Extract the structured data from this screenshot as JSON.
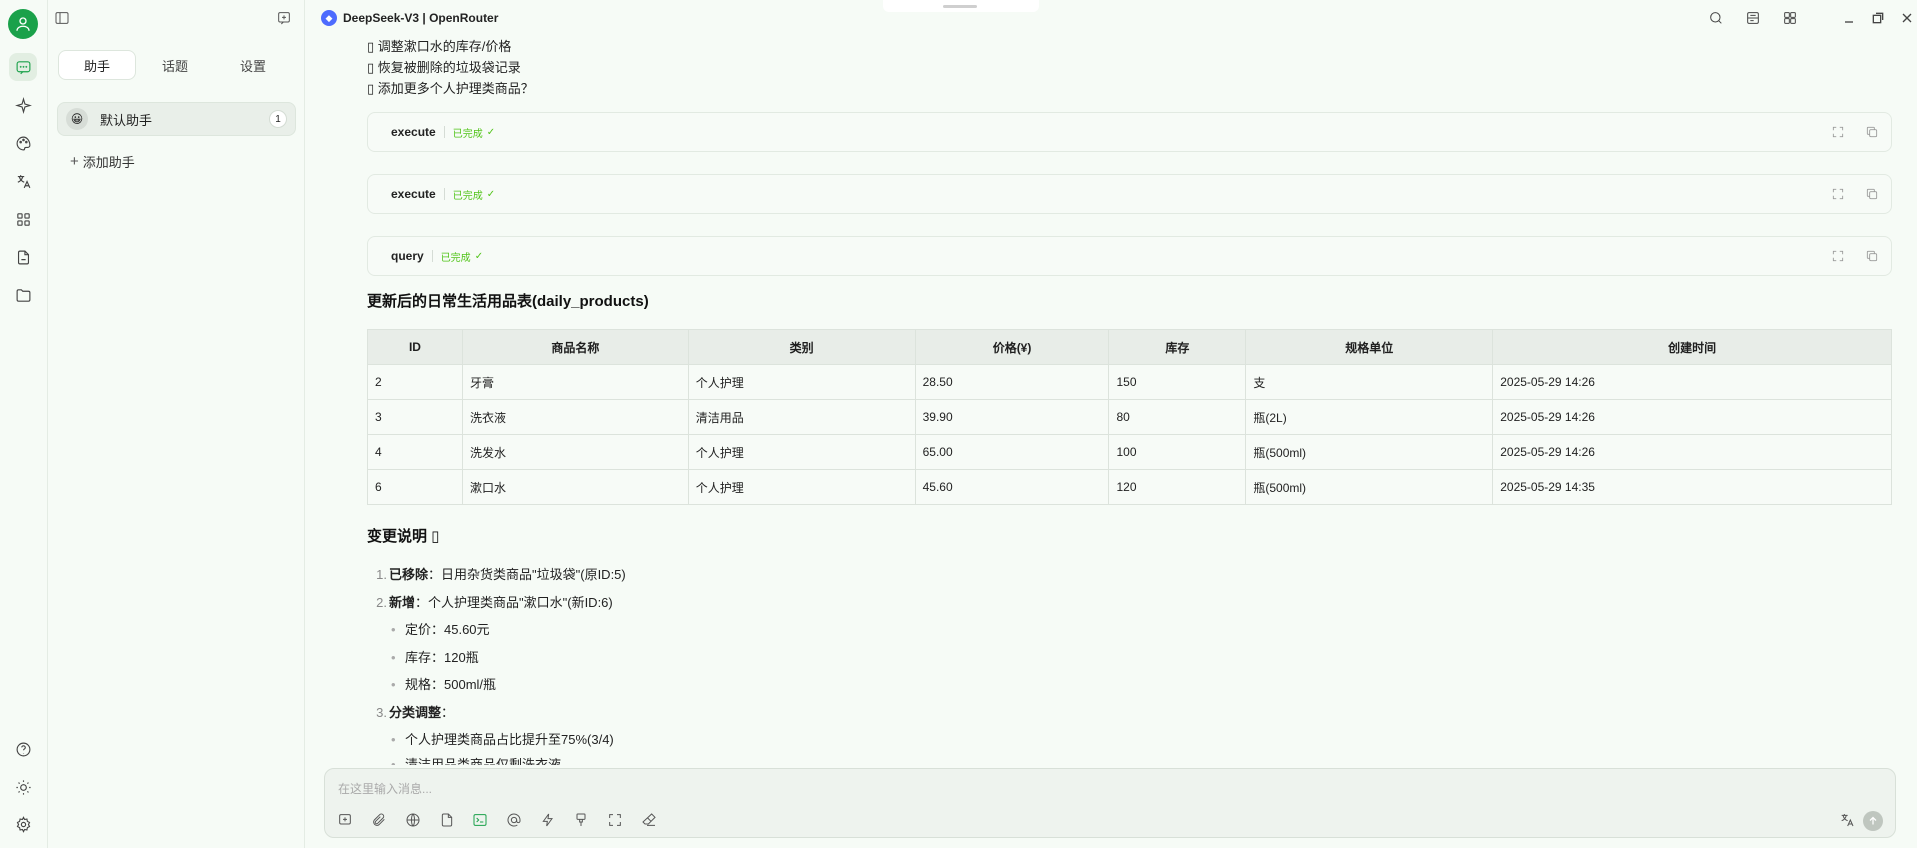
{
  "window": {
    "model_title": "DeepSeek-V3 | OpenRouter",
    "brand_color": "#1aa14a"
  },
  "sidebar": {
    "tabs": [
      "助手",
      "话题",
      "设置"
    ],
    "assistant": {
      "label": "默认助手",
      "count": "1",
      "emoji": "😀"
    },
    "add_label": "添加助手"
  },
  "message": {
    "bullets": [
      "▯ 调整漱口水的库存/价格",
      "▯ 恢复被删除的垃圾袋记录",
      "▯ 添加更多个人护理类商品？"
    ],
    "tool_calls": [
      {
        "name": "execute",
        "status": "已完成"
      },
      {
        "name": "execute",
        "status": "已完成"
      },
      {
        "name": "query",
        "status": "已完成"
      }
    ],
    "table_title": "更新后的日常生活用品表(daily_products)",
    "table": {
      "headers": [
        "ID",
        "商品名称",
        "类别",
        "价格(¥)",
        "库存",
        "规格单位",
        "创建时间"
      ],
      "rows": [
        [
          "2",
          "牙膏",
          "个人护理",
          "28.50",
          "150",
          "支",
          "2025-05-29 14:26"
        ],
        [
          "3",
          "洗衣液",
          "清洁用品",
          "39.90",
          "80",
          "瓶(2L)",
          "2025-05-29 14:26"
        ],
        [
          "4",
          "洗发水",
          "个人护理",
          "65.00",
          "100",
          "瓶(500ml)",
          "2025-05-29 14:26"
        ],
        [
          "6",
          "漱口水",
          "个人护理",
          "45.60",
          "120",
          "瓶(500ml)",
          "2025-05-29 14:35"
        ]
      ]
    },
    "changes_title": "变更说明 ▯",
    "changes": {
      "item1_bold": "已移除",
      "item1_text": "：日用杂货类商品\"垃圾袋\"(原ID:5)",
      "item2_bold": "新增",
      "item2_text": "：个人护理类商品\"漱口水\"(新ID:6)",
      "item2_sub": [
        "定价：45.60元",
        "库存：120瓶",
        "规格：500ml/瓶"
      ],
      "item3_bold": "分类调整",
      "item3_text": "：",
      "item3_sub": [
        "个人护理类商品占比提升至75%(3/4)",
        "清洁用品类商品仅剩洗衣液"
      ]
    }
  },
  "composer": {
    "placeholder": "在这里输入消息..."
  }
}
